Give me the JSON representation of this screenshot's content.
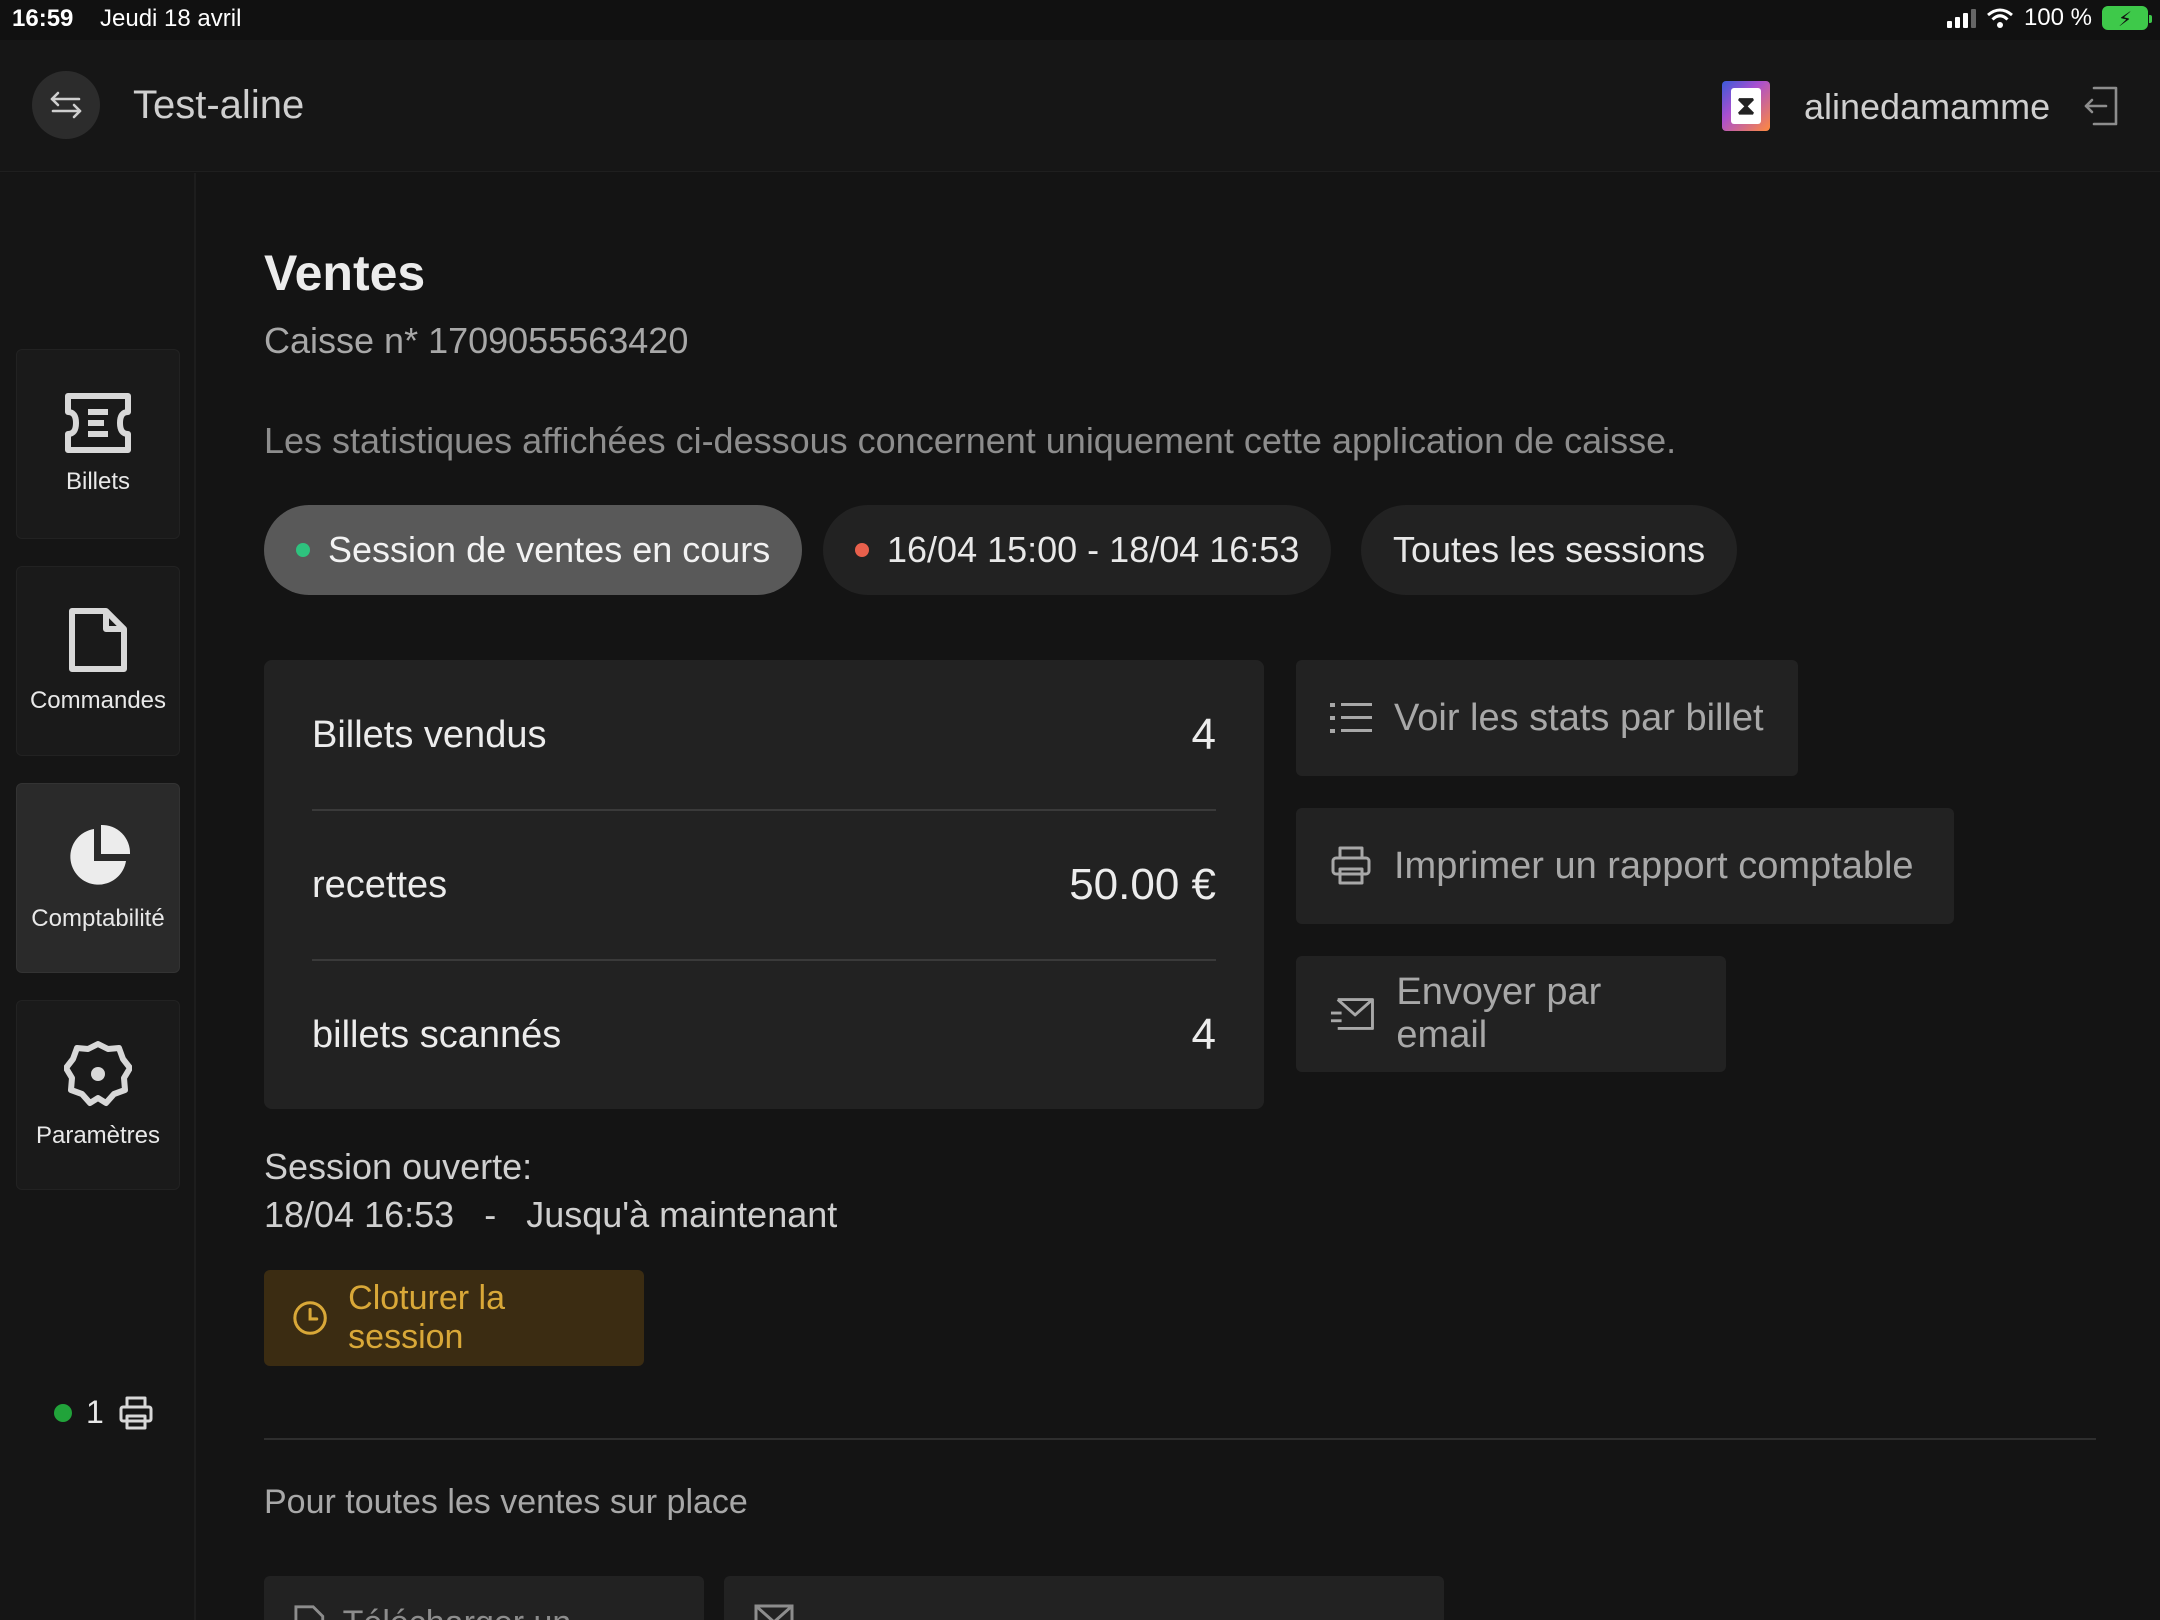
{
  "status_bar": {
    "time": "16:59",
    "date": "Jeudi 18 avril",
    "battery": "100 %",
    "colors": {
      "battery": "#3ec94a"
    }
  },
  "header": {
    "title": "Test-aline",
    "username": "alinedamamme",
    "switch_icon": "swap-arrows-icon",
    "logout_icon": "logout-icon"
  },
  "sidebar": {
    "items": [
      {
        "label": "Billets",
        "icon": "ticket-icon",
        "active": false
      },
      {
        "label": "Commandes",
        "icon": "document-icon",
        "active": false
      },
      {
        "label": "Comptabilité",
        "icon": "pie-chart-icon",
        "active": true
      },
      {
        "label": "Paramètres",
        "icon": "gear-icon",
        "active": false
      }
    ],
    "printer_count": "1",
    "printer_status_color": "#21a33a"
  },
  "main": {
    "title": "Ventes",
    "subtitle": "Caisse n* 1709055563420",
    "note": "Les statistiques affichées ci-dessous concernent uniquement cette application de caisse.",
    "session_tabs": [
      {
        "label": "Session de ventes en cours",
        "dot_color": "#2ec27e",
        "active": true
      },
      {
        "label": "16/04 15:00 - 18/04 16:53",
        "dot_color": "#e8604c",
        "active": false
      },
      {
        "label": "Toutes les sessions",
        "active": false
      }
    ],
    "stats": [
      {
        "label": "Billets vendus",
        "value": "4"
      },
      {
        "label": "recettes",
        "value": "50.00 €"
      },
      {
        "label": "billets scannés",
        "value": "4"
      }
    ],
    "actions": [
      {
        "label": "Voir les stats par billet",
        "icon": "list-icon"
      },
      {
        "label": "Imprimer un rapport comptable",
        "icon": "printer-icon"
      },
      {
        "label": "Envoyer par email",
        "icon": "email-icon"
      }
    ],
    "session": {
      "opened_label": "Session ouverte:",
      "start": "18/04 16:53",
      "separator": "-",
      "end": "Jusqu'à maintenant",
      "close_button": "Cloturer la session",
      "close_color": "#d9a838"
    },
    "onsite_section": {
      "title": "Pour toutes les ventes sur place",
      "buttons": [
        {
          "label": "Télécharger un rapport",
          "icon": "document-download-icon"
        },
        {
          "label": "",
          "icon": "email-icon"
        }
      ]
    }
  }
}
